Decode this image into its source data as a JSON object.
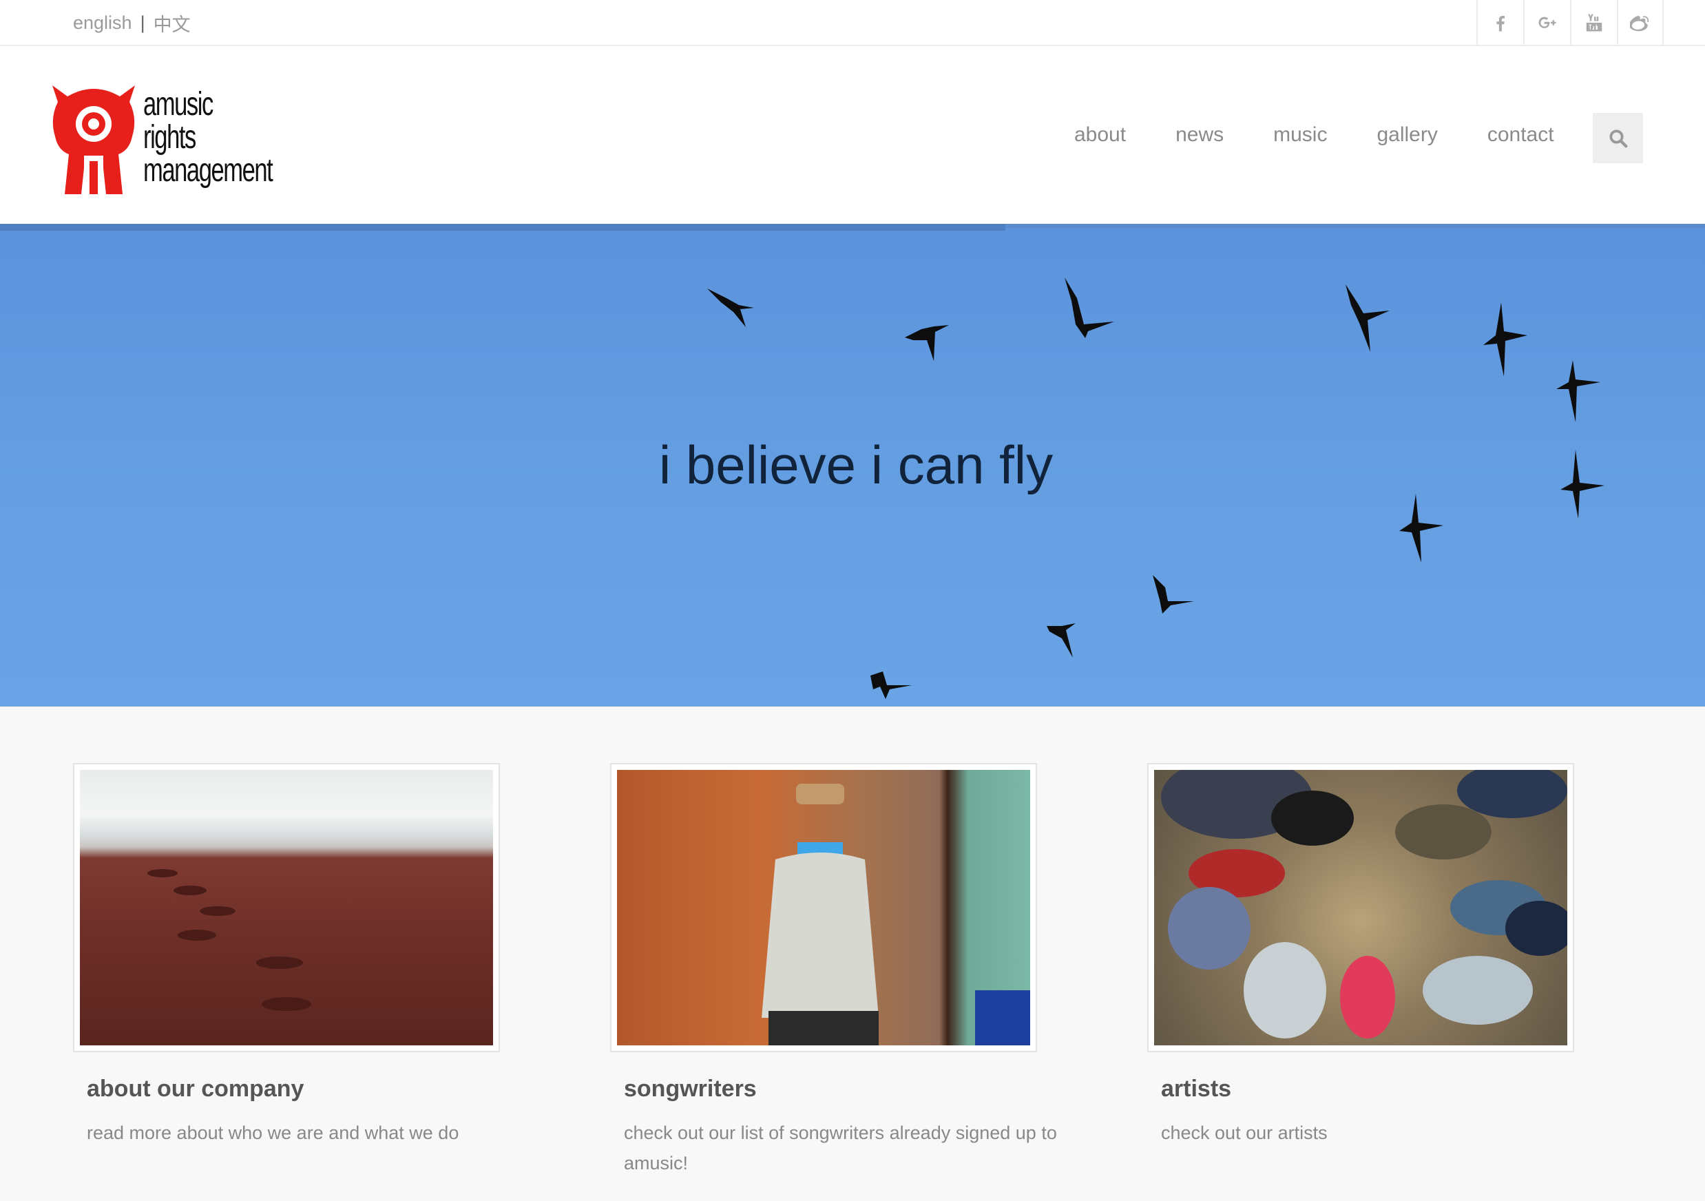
{
  "topbar": {
    "lang_english": "english",
    "lang_separator": "|",
    "lang_chinese": "中文",
    "social": [
      {
        "icon": "facebook-icon"
      },
      {
        "icon": "google-plus-icon"
      },
      {
        "icon": "youtube-icon"
      },
      {
        "icon": "weibo-icon"
      }
    ]
  },
  "logo": {
    "line1": "amusic",
    "line2": "rights",
    "line3": "management",
    "brand_color": "#e8201c"
  },
  "nav": {
    "items": [
      "about",
      "news",
      "music",
      "gallery",
      "contact"
    ]
  },
  "hero": {
    "title": "i believe i can fly",
    "sky_color": "#659fe2"
  },
  "cards": [
    {
      "title": "about our company",
      "text": "read more about who we are and what we do"
    },
    {
      "title": "songwriters",
      "text": "check out our list of songwriters already signed up to amusic!"
    },
    {
      "title": "artists",
      "text": "check out our artists"
    }
  ]
}
